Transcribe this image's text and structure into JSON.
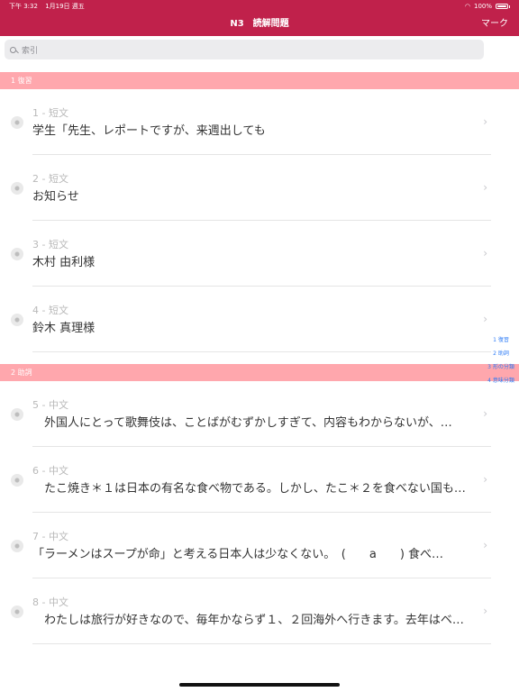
{
  "status_bar": {
    "time": "下午 3:32",
    "date": "1月19日 週五",
    "battery": "100%"
  },
  "nav": {
    "title": "N3　読解問題",
    "right_button": "マーク"
  },
  "search": {
    "placeholder": "索引"
  },
  "sections": [
    {
      "header": "1 復習",
      "rows": [
        {
          "sub": "1 - 短文",
          "title": "学生「先生、レポートですが、来週出しても"
        },
        {
          "sub": "2 - 短文",
          "title": "お知らせ"
        },
        {
          "sub": "3 - 短文",
          "title": "木村 由利様"
        },
        {
          "sub": "4 - 短文",
          "title": "鈴木 真理様"
        }
      ]
    },
    {
      "header": "2 助詞",
      "rows": [
        {
          "sub": "5 - 中文",
          "title": "　外国人にとって歌舞伎は、ことばがむずかしすぎて、内容もわからないが、…"
        },
        {
          "sub": "6 - 中文",
          "title": "　たこ焼き＊１は日本の有名な食べ物である。しかし、たこ＊２を食べない国も…"
        },
        {
          "sub": "7 - 中文",
          "title": "「ラーメンはスープが命」と考える日本人は少なくない。　(　　a　　) 食べ…"
        },
        {
          "sub": "8 - 中文",
          "title": "　わたしは旅行が好きなので、毎年かならず１、２回海外へ行きます。去年はベ…"
        }
      ]
    }
  ],
  "index": [
    "1 復習",
    "2 助詞",
    "3 形の分類",
    "4 意味分類"
  ],
  "colors": {
    "accent": "#c0214b",
    "section_header": "#ffa7ad",
    "index_link": "#2e7cf6"
  }
}
